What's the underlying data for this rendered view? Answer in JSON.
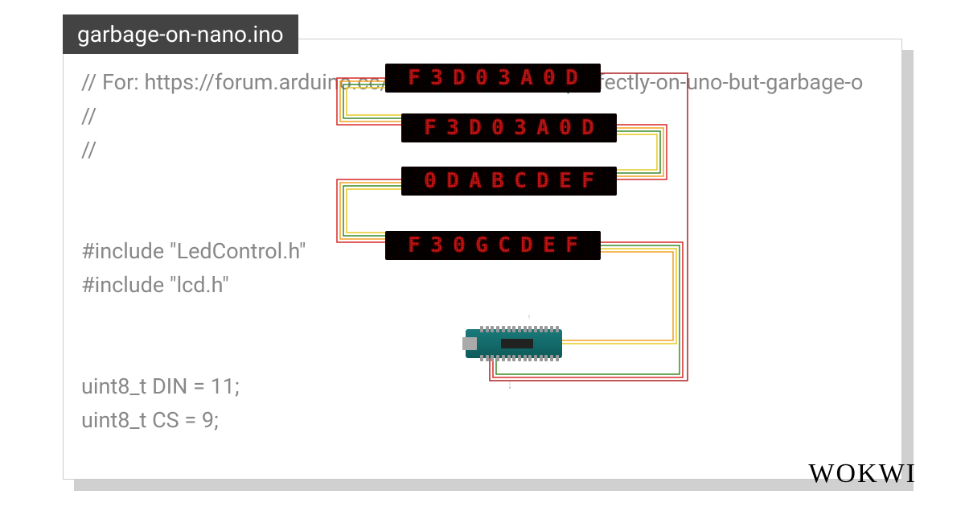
{
  "title": "garbage-on-nano.ino",
  "code": {
    "line1": "// For: https://forum.arduino.cc/t/max7219-works-perfectly-on-uno-but-garbage-o",
    "line2": "//",
    "line3": "//",
    "line4": "",
    "line5": "",
    "line6": "#include \"LedControl.h\"",
    "line7": "#include \"lcd.h\"",
    "line8": "",
    "line9": "",
    "line10": "uint8_t DIN = 11;",
    "line11": "uint8_t CS = 9;"
  },
  "matrix": {
    "row1": "F3D03A0D",
    "row2": "F3D03A0D",
    "row3": "0DABCDEF",
    "row4": "F30GCDEF"
  },
  "logo": "WOKWI",
  "board": "Arduino Nano"
}
